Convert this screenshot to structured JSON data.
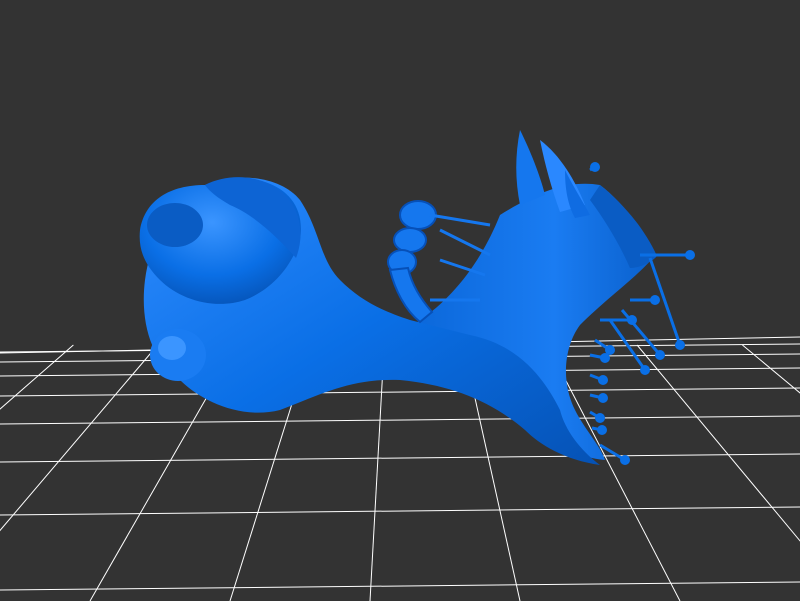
{
  "viewport": {
    "background_color": "#333333",
    "grid_color": "#ffffff",
    "model_color": "#0a6fe6",
    "model_shadow_color": "#0650b8",
    "model_highlight_color": "#3b95ff",
    "grid_visible": true,
    "model_icon": "3d-mesh-icon"
  }
}
